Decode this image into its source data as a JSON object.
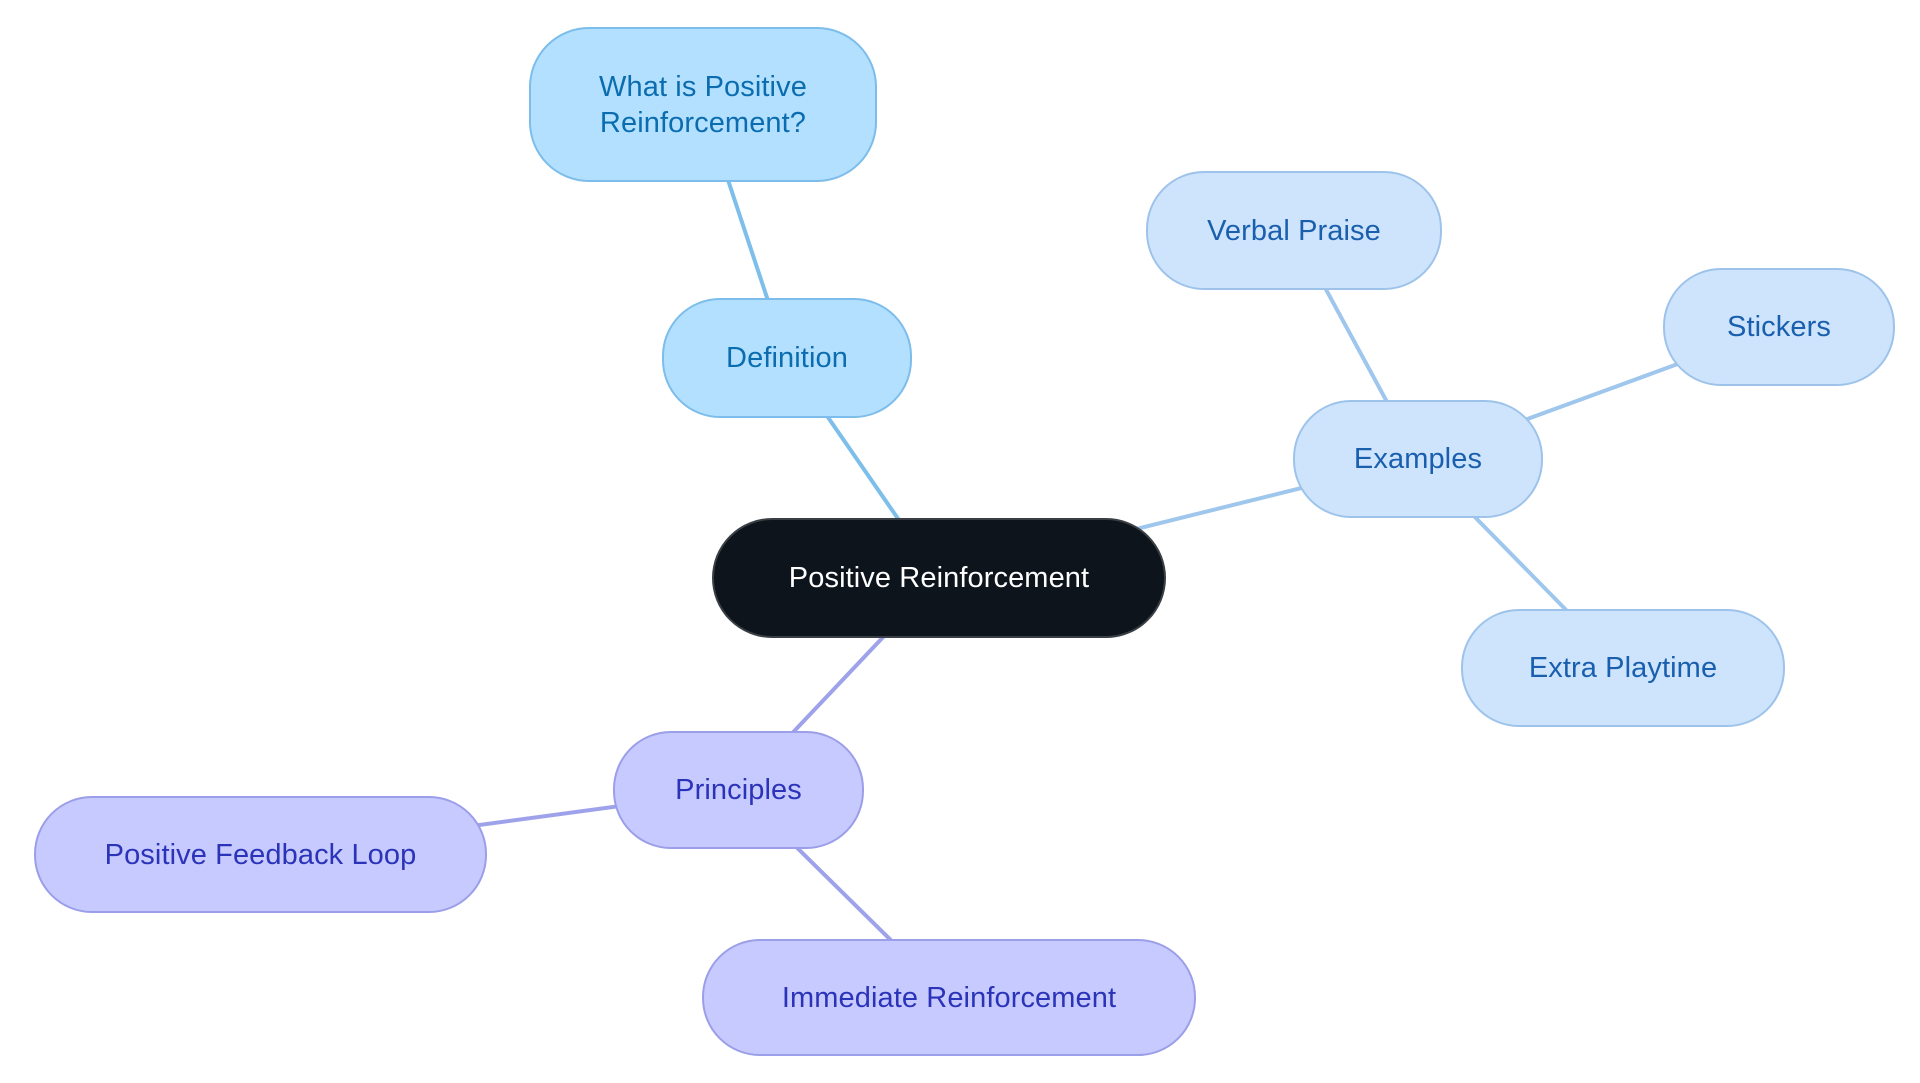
{
  "diagram": {
    "type": "mind-map",
    "root": {
      "id": "root",
      "label": "Positive Reinforcement",
      "color": "#0d141b",
      "text_color": "#ffffff"
    },
    "branches": [
      {
        "id": "def",
        "label": "Definition",
        "fill": "#b3e0ff",
        "stroke": "#7cbdeb",
        "text_color": "#0b6daf",
        "edge_color": "#7dbfea",
        "children": [
          {
            "id": "what",
            "label": "What is Positive\nReinforcement?"
          }
        ]
      },
      {
        "id": "ex",
        "label": "Examples",
        "fill": "#cde4fc",
        "stroke": "#9ec3eb",
        "text_color": "#1a5fae",
        "edge_color": "#9fc6ec",
        "children": [
          {
            "id": "verbal",
            "label": "Verbal Praise"
          },
          {
            "id": "stick",
            "label": "Stickers"
          },
          {
            "id": "extra",
            "label": "Extra Playtime"
          }
        ]
      },
      {
        "id": "prin",
        "label": "Principles",
        "fill": "#c7cafe",
        "stroke": "#9b9ee8",
        "text_color": "#2b33b8",
        "edge_color": "#9ea2ea",
        "children": [
          {
            "id": "pfl",
            "label": "Positive Feedback Loop"
          },
          {
            "id": "imm",
            "label": "Immediate Reinforcement"
          }
        ]
      }
    ],
    "edges": [
      {
        "from": "root",
        "to": "def",
        "branch": "def"
      },
      {
        "from": "def",
        "to": "what",
        "branch": "def"
      },
      {
        "from": "root",
        "to": "ex",
        "branch": "ex"
      },
      {
        "from": "ex",
        "to": "verbal",
        "branch": "ex"
      },
      {
        "from": "ex",
        "to": "stick",
        "branch": "ex"
      },
      {
        "from": "ex",
        "to": "extra",
        "branch": "ex"
      },
      {
        "from": "root",
        "to": "prin",
        "branch": "prin"
      },
      {
        "from": "prin",
        "to": "pfl",
        "branch": "prin"
      },
      {
        "from": "prin",
        "to": "imm",
        "branch": "prin"
      }
    ]
  }
}
